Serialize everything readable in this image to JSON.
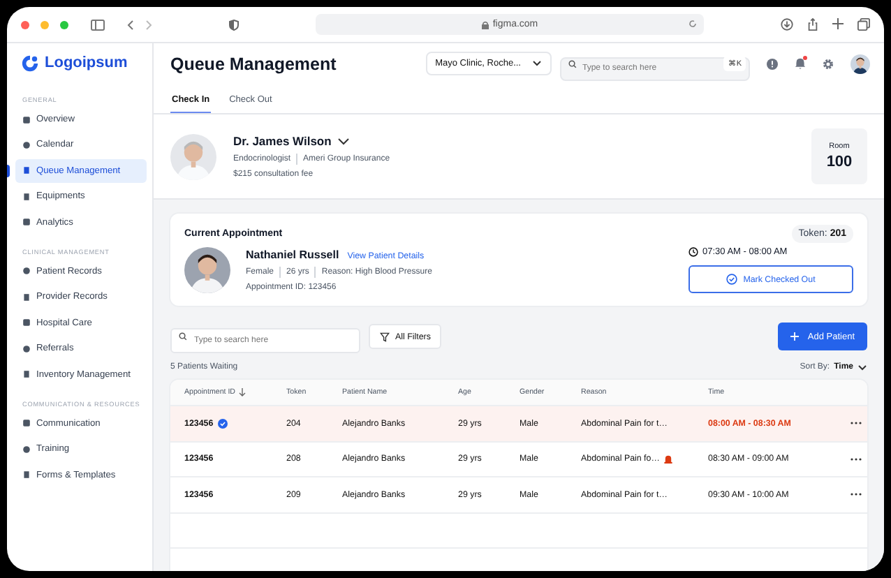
{
  "browser": {
    "url": "figma.com"
  },
  "logo": {
    "text": "Logoipsum"
  },
  "sidebar": {
    "sections": [
      {
        "title": "GENERAL",
        "items": [
          {
            "label": "Overview",
            "selected": false
          },
          {
            "label": "Calendar",
            "selected": false
          },
          {
            "label": "Queue Management",
            "selected": true
          },
          {
            "label": "Equipments",
            "selected": false
          },
          {
            "label": "Analytics",
            "selected": false
          }
        ]
      },
      {
        "title": "CLINICAL MANAGEMENT",
        "items": [
          {
            "label": "Patient Records",
            "selected": false
          },
          {
            "label": "Provider Records",
            "selected": false
          },
          {
            "label": "Hospital Care",
            "selected": false
          },
          {
            "label": "Referrals",
            "selected": false
          },
          {
            "label": "Inventory Management",
            "selected": false
          }
        ]
      },
      {
        "title": "COMMUNICATION & RESOURCES",
        "items": [
          {
            "label": "Communication",
            "selected": false
          },
          {
            "label": "Training",
            "selected": false
          },
          {
            "label": "Forms & Templates",
            "selected": false
          }
        ]
      }
    ]
  },
  "header": {
    "title": "Queue Management",
    "location": "Mayo Clinic, Roche...",
    "search": {
      "placeholder": "Type to search here",
      "shortcut": "⌘K"
    },
    "notification_dot": true
  },
  "tabs": [
    {
      "label": "Check In",
      "selected": true
    },
    {
      "label": "Check Out",
      "selected": false
    }
  ],
  "doctor": {
    "name": "Dr. James Wilson",
    "specialty": "Endocrinologist",
    "insurance": "Ameri Group Insurance",
    "fee": "$215 consultation fee",
    "room_label": "Room",
    "room": "100"
  },
  "current_appointment": {
    "title": "Current Appointment",
    "token_label": "Token:",
    "token": "201",
    "patient": "Nathaniel Russell",
    "link": "View Patient Details",
    "gender": "Female",
    "age": "26 yrs",
    "reason": "Reason: High Blood Pressure",
    "appointment_id": "Appointment ID: 123456",
    "time": "07:30 AM - 08:00 AM",
    "button": "Mark Checked Out"
  },
  "toolbar": {
    "search": {
      "placeholder": "Type to search here"
    },
    "filter": "All Filters",
    "add": "Add Patient"
  },
  "queue": {
    "count": "5 Patients Waiting",
    "sort_label": "Sort By:",
    "sort_value": "Time"
  },
  "table": {
    "columns": [
      "Appointment ID",
      "Token",
      "Patient Name",
      "Age",
      "Gender",
      "Reason",
      "Time"
    ],
    "rows": [
      {
        "id": "123456",
        "token": "204",
        "name": "Alejandro Banks",
        "age": "29 yrs",
        "gender": "Male",
        "reason": "Abdominal Pain for t…",
        "time": "08:00 AM - 08:30 AM",
        "current": true,
        "verified": true,
        "alert": false
      },
      {
        "id": "123456",
        "token": "208",
        "name": "Alejandro Banks",
        "age": "29 yrs",
        "gender": "Male",
        "reason": "Abdominal Pain fo…",
        "time": "08:30 AM - 09:00 AM",
        "current": false,
        "verified": false,
        "alert": true
      },
      {
        "id": "123456",
        "token": "209",
        "name": "Alejandro Banks",
        "age": "29 yrs",
        "gender": "Male",
        "reason": "Abdominal Pain for t…",
        "time": "09:30 AM - 10:00 AM",
        "current": false,
        "verified": false,
        "alert": false
      }
    ]
  }
}
